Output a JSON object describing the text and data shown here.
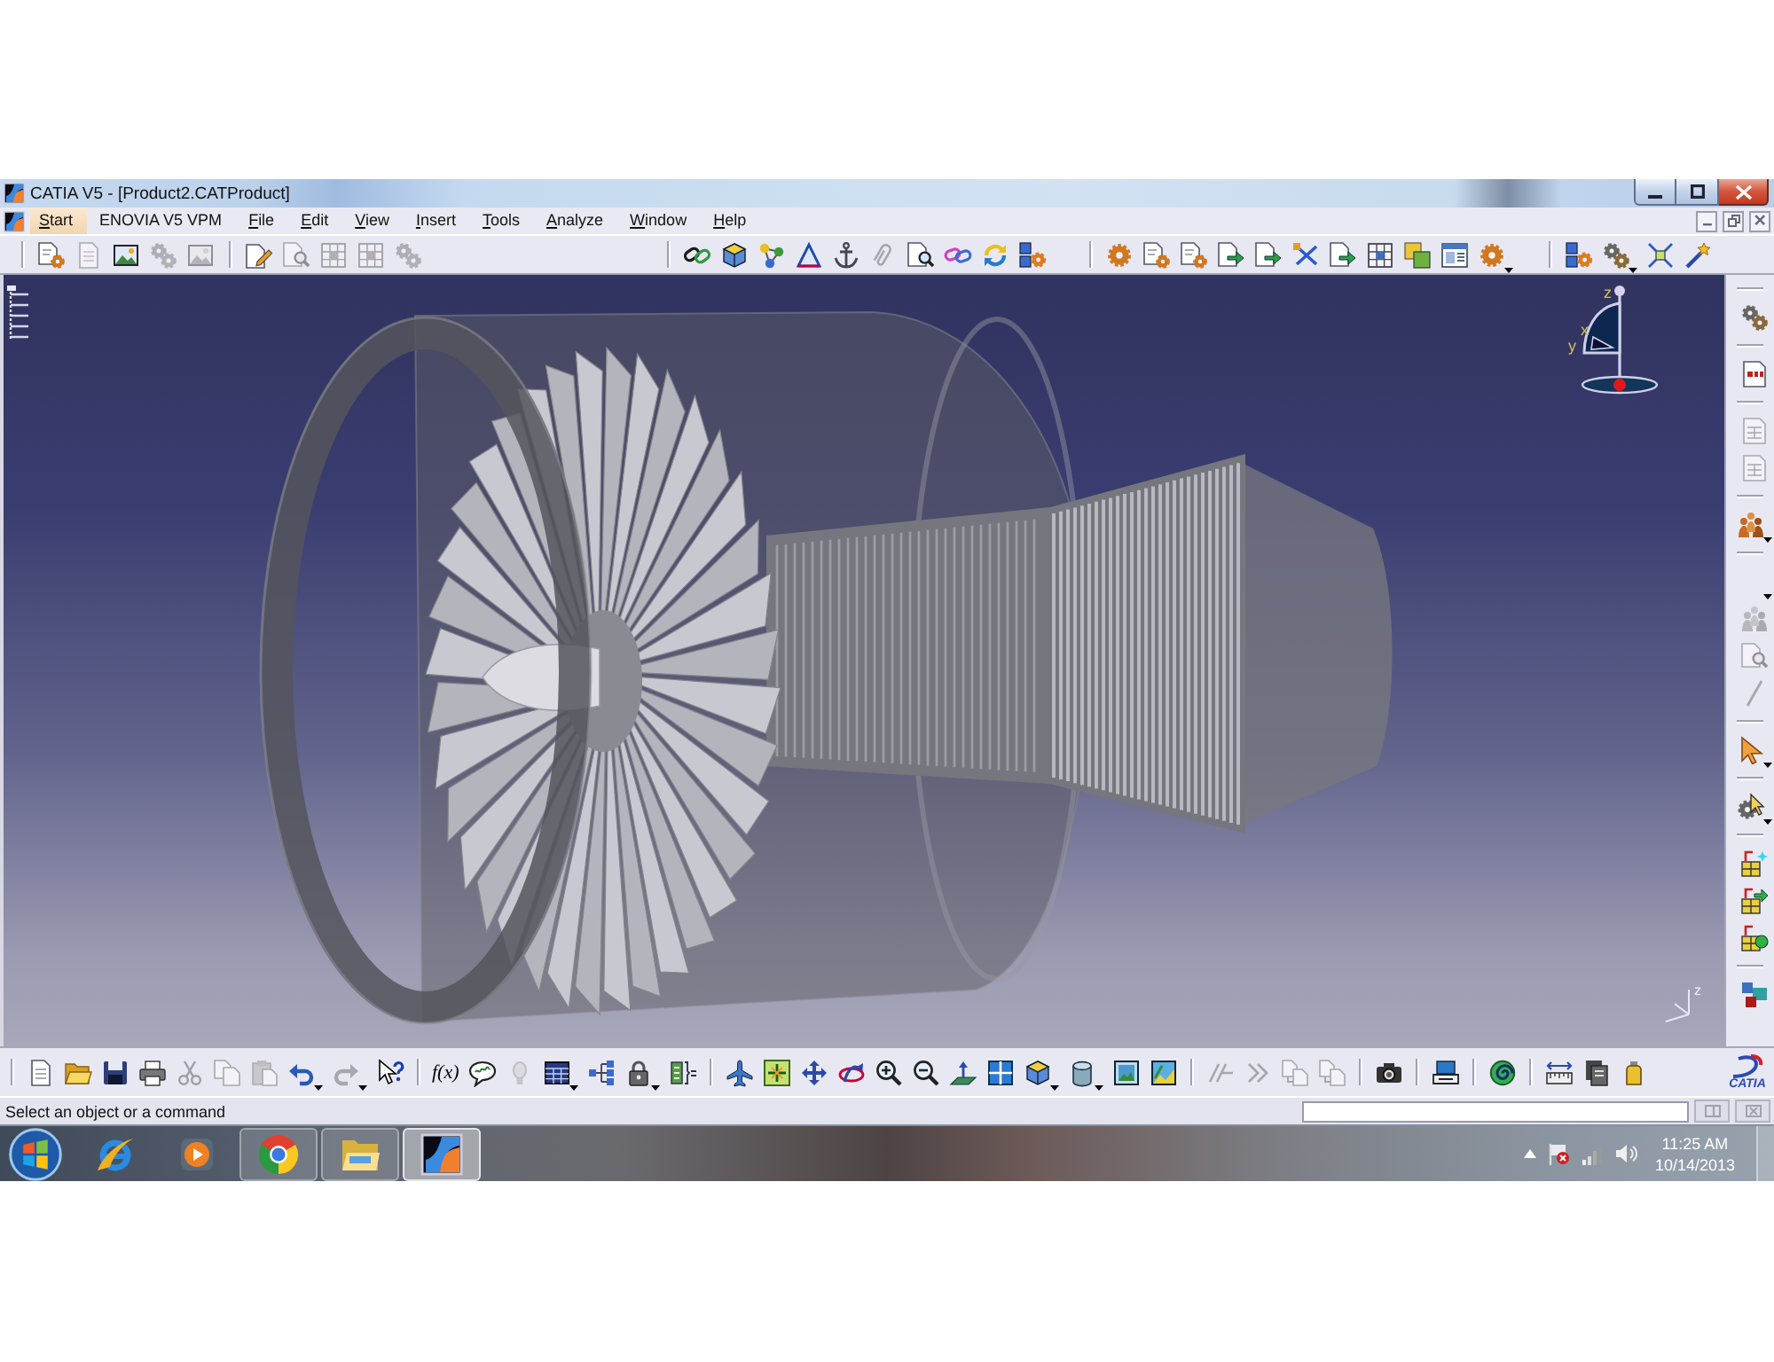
{
  "window": {
    "title": "CATIA V5 - [Product2.CATProduct]"
  },
  "menu_bar": {
    "items": [
      {
        "label": "Start",
        "selected": true,
        "mnemonic": true
      },
      {
        "label": "ENOVIA V5 VPM",
        "selected": false,
        "mnemonic": false
      },
      {
        "label": "File",
        "selected": false,
        "mnemonic": true
      },
      {
        "label": "Edit",
        "selected": false,
        "mnemonic": true
      },
      {
        "label": "View",
        "selected": false,
        "mnemonic": true
      },
      {
        "label": "Insert",
        "selected": false,
        "mnemonic": true
      },
      {
        "label": "Tools",
        "selected": false,
        "mnemonic": true
      },
      {
        "label": "Analyze",
        "selected": false,
        "mnemonic": true
      },
      {
        "label": "Window",
        "selected": false,
        "mnemonic": true
      },
      {
        "label": "Help",
        "selected": false,
        "mnemonic": true
      }
    ]
  },
  "toolbars": {
    "top": [
      {
        "items": [
          {
            "kind": "gear-doc",
            "disabled": false
          },
          {
            "kind": "doc",
            "disabled": true
          },
          {
            "kind": "picture",
            "disabled": false
          },
          {
            "kind": "gears",
            "disabled": true
          },
          {
            "kind": "picture",
            "disabled": true
          }
        ]
      },
      {
        "items": [
          {
            "kind": "doc-pencil",
            "disabled": false
          },
          {
            "kind": "doc-magnifier",
            "disabled": true
          },
          {
            "kind": "grid",
            "disabled": true
          },
          {
            "kind": "grid",
            "disabled": true
          },
          {
            "kind": "gears",
            "disabled": true
          }
        ]
      },
      {
        "items": [
          {
            "kind": "chain",
            "disabled": false
          },
          {
            "kind": "cube",
            "disabled": false
          },
          {
            "kind": "molecule",
            "disabled": false
          },
          {
            "kind": "triangle",
            "disabled": false
          },
          {
            "kind": "anchor",
            "disabled": false
          },
          {
            "kind": "clip",
            "disabled": true
          },
          {
            "kind": "doc-magnifier",
            "disabled": false
          },
          {
            "kind": "chain2",
            "disabled": false
          },
          {
            "kind": "cycle",
            "disabled": false
          },
          {
            "kind": "gear-blocks",
            "disabled": false
          }
        ]
      },
      {
        "items": [
          {
            "kind": "gear",
            "disabled": false
          },
          {
            "kind": "gear-doc",
            "disabled": false
          },
          {
            "kind": "gear-doc",
            "disabled": false
          },
          {
            "kind": "doc-arrow",
            "disabled": false
          },
          {
            "kind": "doc-arrow",
            "disabled": false
          },
          {
            "kind": "cross-link",
            "disabled": false
          },
          {
            "kind": "doc-arrow",
            "disabled": false
          },
          {
            "kind": "grid",
            "disabled": false
          },
          {
            "kind": "tiles",
            "disabled": false
          },
          {
            "kind": "windows",
            "disabled": false
          },
          {
            "kind": "gear",
            "disabled": false,
            "dropdown": true
          }
        ]
      },
      {
        "items": [
          {
            "kind": "gear-blocks",
            "disabled": false
          },
          {
            "kind": "gears",
            "disabled": false,
            "dropdown": true
          },
          {
            "kind": "expand",
            "disabled": false
          },
          {
            "kind": "wand",
            "disabled": false
          }
        ]
      }
    ],
    "bottom": [
      {
        "items": [
          {
            "kind": "doc",
            "disabled": false
          },
          {
            "kind": "folder",
            "disabled": false
          },
          {
            "kind": "floppy",
            "disabled": false
          },
          {
            "kind": "printer",
            "disabled": false
          },
          {
            "kind": "scissors",
            "disabled": true
          },
          {
            "kind": "copy",
            "disabled": true
          },
          {
            "kind": "paste",
            "disabled": true
          },
          {
            "kind": "undo",
            "disabled": false,
            "dropdown": true
          },
          {
            "kind": "redo",
            "disabled": true,
            "dropdown": true
          },
          {
            "kind": "help",
            "disabled": false
          }
        ]
      },
      {
        "items": [
          {
            "kind": "text",
            "label": "f(x)",
            "disabled": false
          },
          {
            "kind": "bubble",
            "disabled": false
          },
          {
            "kind": "bulb",
            "disabled": true
          },
          {
            "kind": "table",
            "disabled": false,
            "dropdown": true
          },
          {
            "kind": "tree",
            "disabled": false
          },
          {
            "kind": "lock",
            "disabled": false,
            "dropdown": true
          },
          {
            "kind": "bracket",
            "disabled": false
          }
        ]
      },
      {
        "items": [
          {
            "kind": "plane",
            "disabled": false
          },
          {
            "kind": "fit",
            "disabled": false
          },
          {
            "kind": "pan",
            "disabled": false
          },
          {
            "kind": "rotate",
            "disabled": false
          },
          {
            "kind": "zoom-in",
            "disabled": false
          },
          {
            "kind": "zoom-out",
            "disabled": false
          },
          {
            "kind": "normal",
            "disabled": false
          },
          {
            "kind": "views",
            "disabled": false
          },
          {
            "kind": "cube",
            "disabled": false,
            "dropdown": true
          },
          {
            "kind": "shade",
            "disabled": false,
            "dropdown": true
          },
          {
            "kind": "hide",
            "disabled": false
          },
          {
            "kind": "swap",
            "disabled": false
          }
        ]
      },
      {
        "items": [
          {
            "kind": "sketch",
            "disabled": true
          },
          {
            "kind": "chevrons",
            "disabled": true
          },
          {
            "kind": "linked-pages",
            "disabled": true
          },
          {
            "kind": "linked-pages",
            "disabled": true
          }
        ]
      },
      {
        "items": [
          {
            "kind": "camera",
            "disabled": false
          }
        ]
      },
      {
        "items": [
          {
            "kind": "monitor",
            "disabled": false
          }
        ]
      },
      {
        "items": [
          {
            "kind": "spiral",
            "disabled": false
          }
        ]
      },
      {
        "items": [
          {
            "kind": "ruler",
            "disabled": false
          },
          {
            "kind": "stack",
            "disabled": false
          },
          {
            "kind": "bottle",
            "disabled": false
          }
        ]
      }
    ],
    "right": [
      {
        "items": [
          {
            "kind": "gears",
            "disabled": false
          }
        ]
      },
      {
        "items": [
          {
            "kind": "report",
            "disabled": false
          }
        ]
      },
      {
        "items": [
          {
            "kind": "doc-grid",
            "disabled": true
          },
          {
            "kind": "doc-grid",
            "disabled": true
          }
        ]
      },
      {
        "items": [
          {
            "kind": "figures",
            "disabled": false,
            "dropdown": true
          }
        ]
      },
      {
        "items": [
          {
            "kind": "blank",
            "dropdown": true
          },
          {
            "kind": "figures",
            "disabled": true
          },
          {
            "kind": "doc-magnifier",
            "disabled": true
          },
          {
            "kind": "slash",
            "disabled": true
          }
        ]
      },
      {
        "items": [
          {
            "kind": "pointer",
            "disabled": false,
            "dropdown": true
          }
        ]
      },
      {
        "items": [
          {
            "kind": "gear-pointer",
            "disabled": false,
            "dropdown": true
          }
        ]
      },
      {
        "items": [
          {
            "kind": "blocks-spark",
            "disabled": false
          },
          {
            "kind": "blocks-arrow",
            "disabled": false
          },
          {
            "kind": "blocks-circle",
            "disabled": false
          }
        ]
      },
      {
        "items": [
          {
            "kind": "colored-blocks",
            "disabled": false
          }
        ]
      }
    ]
  },
  "viewport": {
    "compass_labels": [
      "z",
      "x",
      "y"
    ],
    "triad_label": "z"
  },
  "logo": {
    "text": "CATIA"
  },
  "status_bar": {
    "message": "Select an object or a command",
    "buttons": [
      {
        "kind": "restore",
        "disabled": true
      },
      {
        "kind": "close",
        "disabled": true
      }
    ]
  },
  "taskbar": {
    "apps": [
      {
        "kind": "ie",
        "open": false,
        "selected": false
      },
      {
        "kind": "media",
        "open": false,
        "selected": false
      },
      {
        "kind": "chrome",
        "open": true,
        "selected": false
      },
      {
        "kind": "explorer",
        "open": true,
        "selected": false
      },
      {
        "kind": "catia",
        "open": true,
        "selected": true
      }
    ],
    "clock": {
      "time": "11:25 AM",
      "date": "10/14/2013"
    }
  }
}
